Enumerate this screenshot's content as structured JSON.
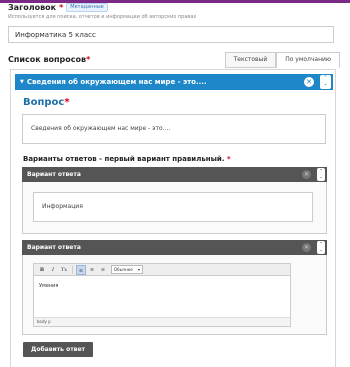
{
  "header": {
    "title": "Заголовок",
    "metadata_badge": "Метаданные",
    "help_text": "Используется для поиска, отчетов и информации об авторских правах",
    "title_value": "Информатика 5 класс"
  },
  "questions": {
    "label": "Список вопросов",
    "tabs": [
      {
        "label": "Текстовый"
      },
      {
        "label": "По умолчанию"
      }
    ],
    "item_title": "Сведения об окружающем нас мире - это...."
  },
  "question_editor": {
    "label": "Вопрос",
    "text": "Сведения об окружающем нас мире - это....",
    "answers_label": "Варианты ответов - первый вариант правильный.",
    "answers": [
      {
        "header": "Вариант ответа",
        "value": "Информация"
      },
      {
        "header": "Вариант ответа",
        "value": "Умения"
      }
    ],
    "toolbar": {
      "bold": "B",
      "italic": "I",
      "clear": "Tx",
      "format_value": "Обычное",
      "status_path": "body p"
    },
    "add_button": "Добавить ответ"
  },
  "colors": {
    "accent": "#1d87c9",
    "topbar": "#7a2a86",
    "answer_header": "#555555",
    "required": "#d0021b"
  }
}
